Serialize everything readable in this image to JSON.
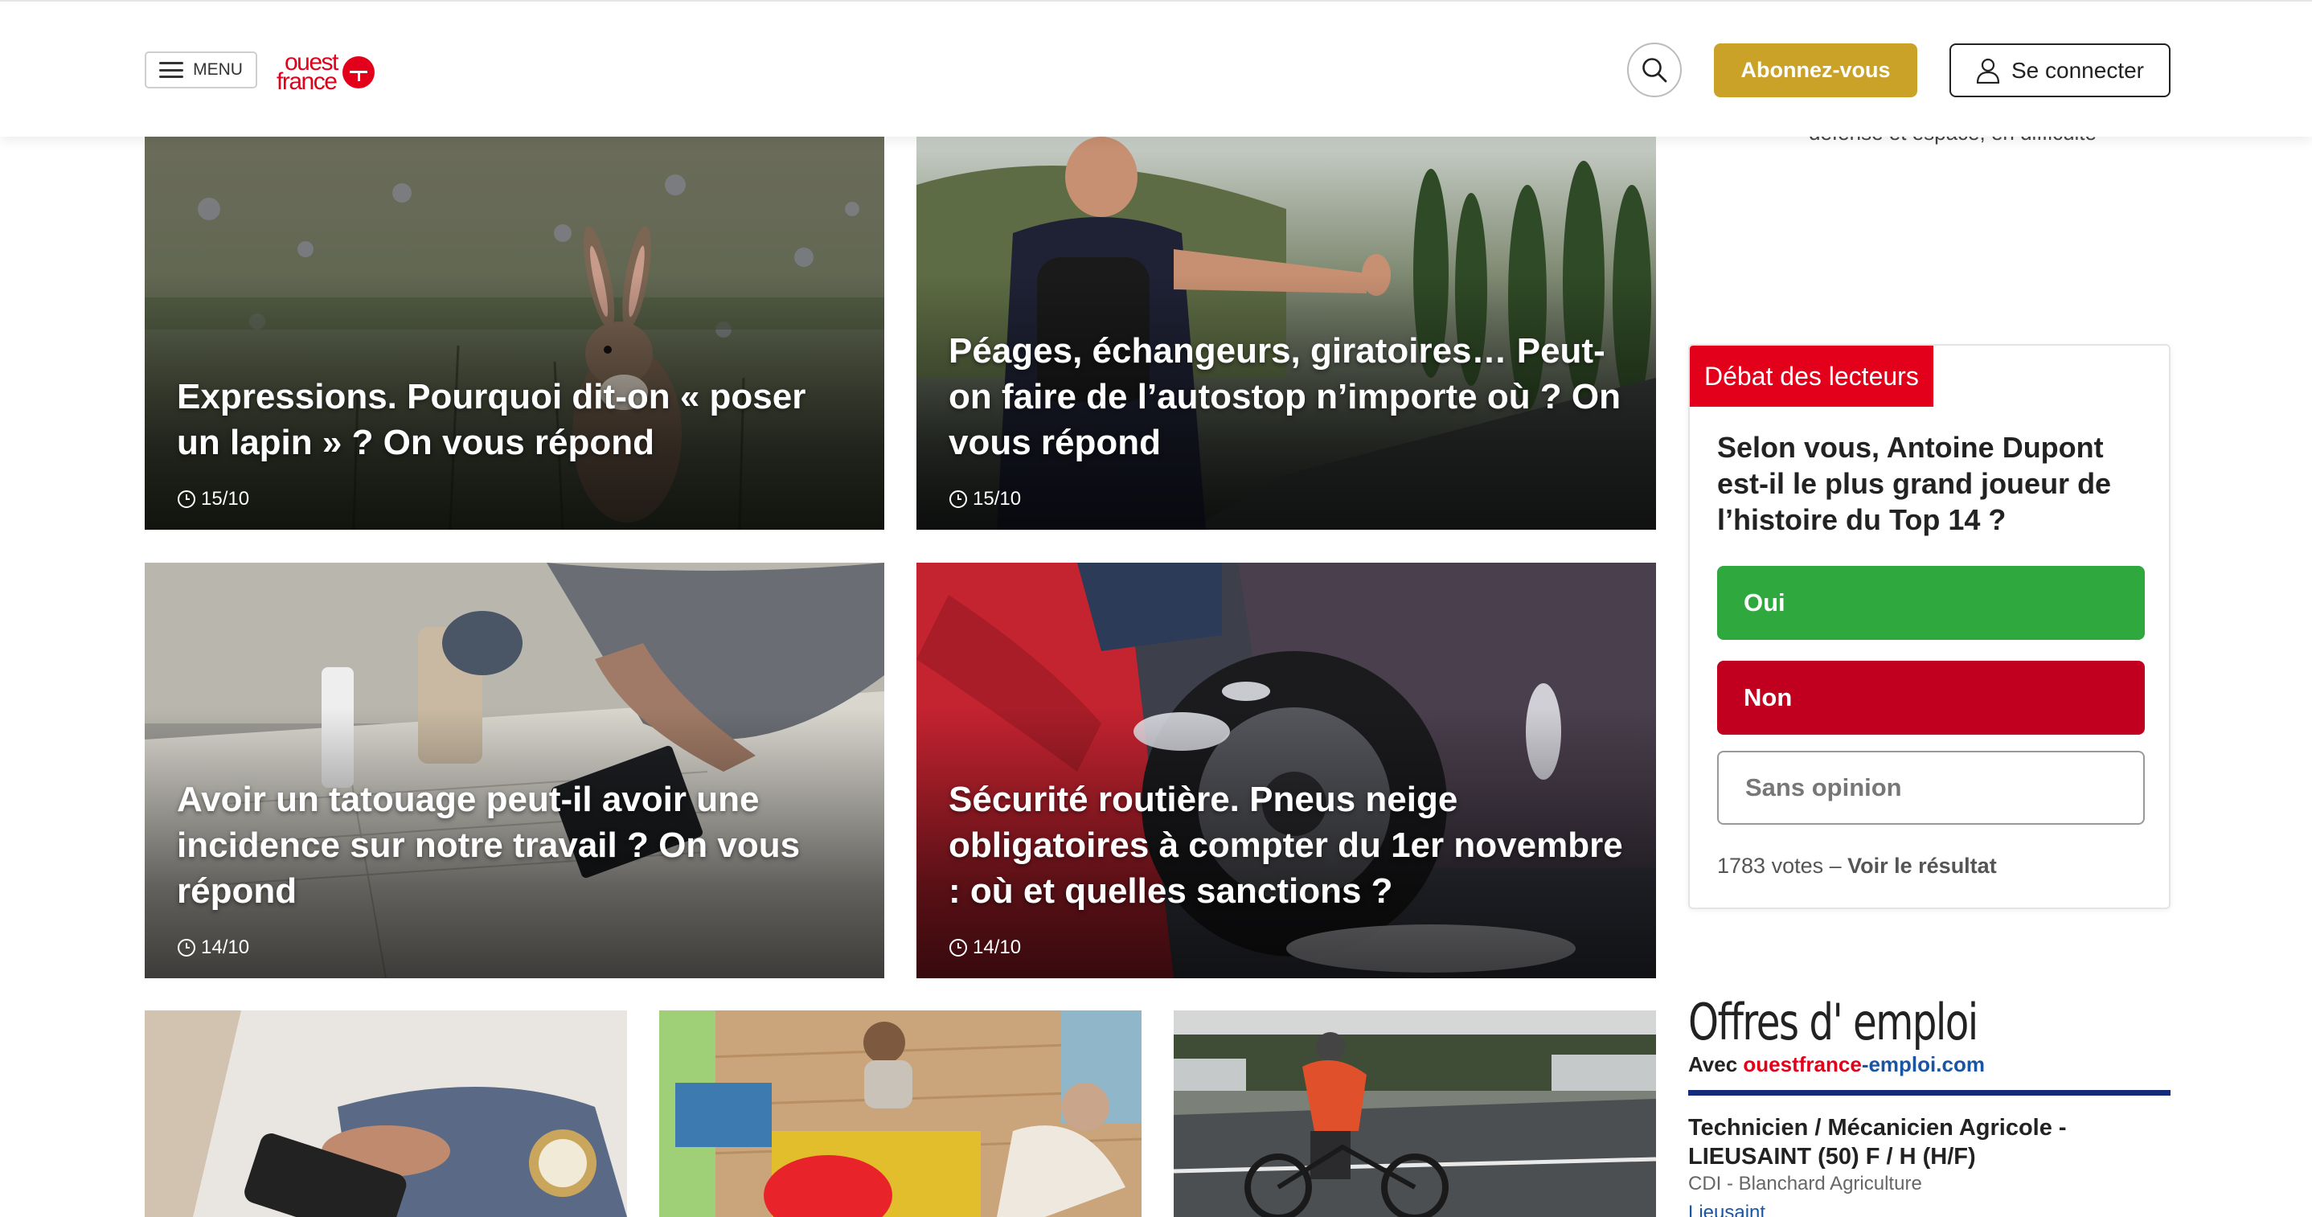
{
  "header": {
    "menu_label": "MENU",
    "logo_line1": "ouest",
    "logo_line2": "france",
    "subscribe_label": "Abonnez-vous",
    "login_label": "Se connecter"
  },
  "cut_text": "défense et espace, en difficulté",
  "articles": [
    {
      "title": "Expressions. Pourquoi dit-on « poser un lapin » ? On vous répond",
      "date": "15/10"
    },
    {
      "title": "Péages, échangeurs, giratoires… Peut-on faire de l’autostop n’importe où ? On vous répond",
      "date": "15/10"
    },
    {
      "title": "Avoir un tatouage peut-il avoir une incidence sur notre travail ? On vous répond",
      "date": "14/10"
    },
    {
      "title": "Sécurité routière. Pneus neige obligatoires à compter du 1er novembre : où et quelles sanctions ?",
      "date": "14/10"
    }
  ],
  "debate": {
    "badge": "Débat des lecteurs",
    "question": "Selon vous, Antoine Dupont est-il le plus grand joueur de l’histoire du Top 14 ?",
    "options": [
      "Oui",
      "Non",
      "Sans opinion"
    ],
    "votes_text": "1783 votes – ",
    "result_link": "Voir le résultat"
  },
  "jobs": {
    "heading": "Offres d' emploi",
    "sub_prefix": "Avec ",
    "sub_red": "ouestfrance",
    "sub_blue": "-emploi.com",
    "offer_title": "Technicien / Mécanicien Agricole - LIEUSAINT (50) F / H (H/F)",
    "offer_company": "CDI - Blanchard Agriculture",
    "offer_location": "Lieusaint"
  },
  "colors": {
    "brand_red": "#e2001a",
    "subscribe_gold": "#c9a227",
    "yes_green": "#2fa83d",
    "no_red": "#c1001f",
    "jobs_navy": "#152b7a"
  }
}
